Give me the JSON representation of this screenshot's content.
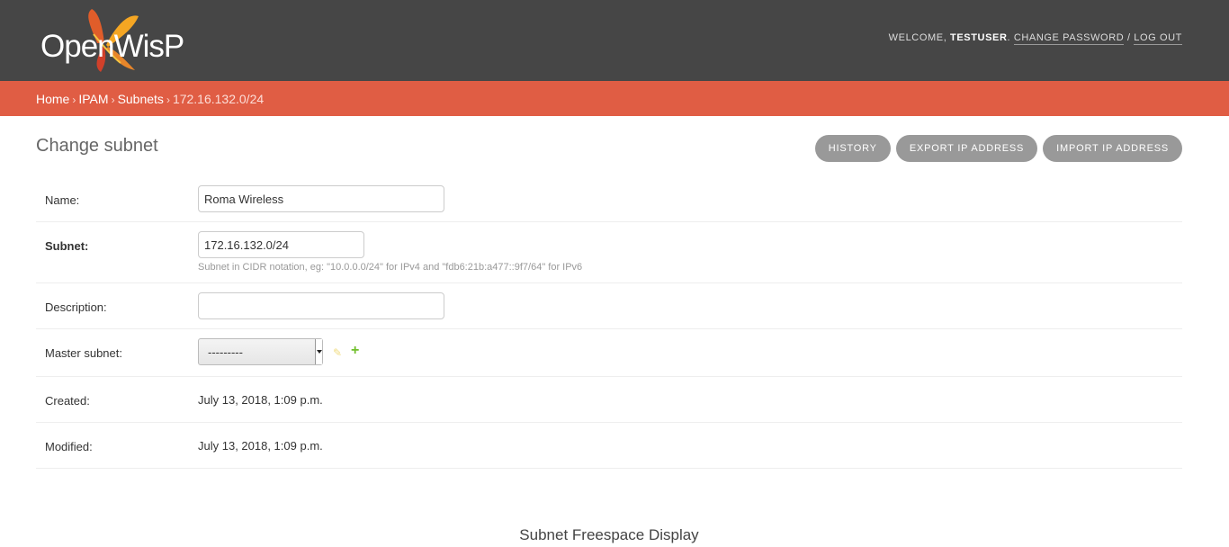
{
  "header": {
    "logo_text": "OpenWisP",
    "welcome_label": "WELCOME,",
    "username": "TESTUSER",
    "change_password": "CHANGE PASSWORD",
    "separator": "/",
    "log_out": "LOG OUT"
  },
  "breadcrumbs": {
    "items": [
      "Home",
      "IPAM",
      "Subnets"
    ],
    "separator": "›",
    "current": "172.16.132.0/24"
  },
  "page": {
    "title": "Change subnet"
  },
  "object_tools": {
    "history": "HISTORY",
    "export": "EXPORT IP ADDRESS",
    "import": "IMPORT IP ADDRESS"
  },
  "form": {
    "name": {
      "label": "Name:",
      "value": "Roma Wireless"
    },
    "subnet": {
      "label": "Subnet:",
      "value": "172.16.132.0/24",
      "help": "Subnet in CIDR notation, eg: \"10.0.0.0/24\" for IPv4 and \"fdb6:21b:a477::9f7/64\" for IPv6"
    },
    "description": {
      "label": "Description:",
      "value": ""
    },
    "master_subnet": {
      "label": "Master subnet:",
      "selected": "---------"
    },
    "created": {
      "label": "Created:",
      "value": "July 13, 2018, 1:09 p.m."
    },
    "modified": {
      "label": "Modified:",
      "value": "July 13, 2018, 1:09 p.m."
    }
  },
  "freespace": {
    "title": "Subnet Freespace Display"
  },
  "colors": {
    "header_bg": "#464646",
    "breadcrumbs_bg": "#e05d44",
    "button_bg": "#999999",
    "add_icon": "#70bf2b",
    "edit_icon": "#f0dc82"
  },
  "icons": {
    "edit": "pencil-icon",
    "add": "plus-icon",
    "dropdown": "caret-down-icon"
  }
}
